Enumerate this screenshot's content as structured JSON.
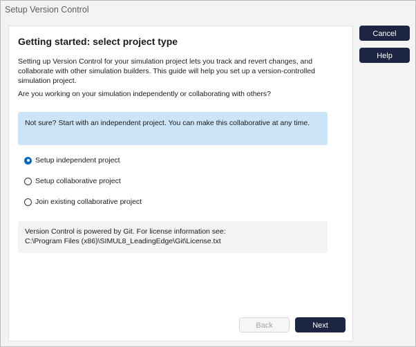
{
  "window": {
    "title": "Setup Version Control"
  },
  "actions": {
    "cancel_label": "Cancel",
    "help_label": "Help"
  },
  "page": {
    "heading": "Getting started: select project type",
    "description_lines": [
      "Setting up Version Control for your simulation project lets you track and revert changes, and",
      "collaborate with other simulation builders. This guide will help you set up a version-controlled",
      "simulation project."
    ],
    "question": "Are you working on your simulation independently or collaborating with others?",
    "hint": "Not sure? Start with an independent project. You can make this collaborative at any time.",
    "options": [
      {
        "label": "Setup independent project",
        "selected": true
      },
      {
        "label": "Setup collaborative project",
        "selected": false
      },
      {
        "label": "Join existing collaborative project",
        "selected": false
      }
    ],
    "license_lines": [
      "Version Control is powered by Git. For license information see:",
      "C:\\Program Files (x86)\\SIMUL8_LeadingEdge\\Git\\License.txt"
    ]
  },
  "nav": {
    "back_label": "Back",
    "next_label": "Next"
  }
}
